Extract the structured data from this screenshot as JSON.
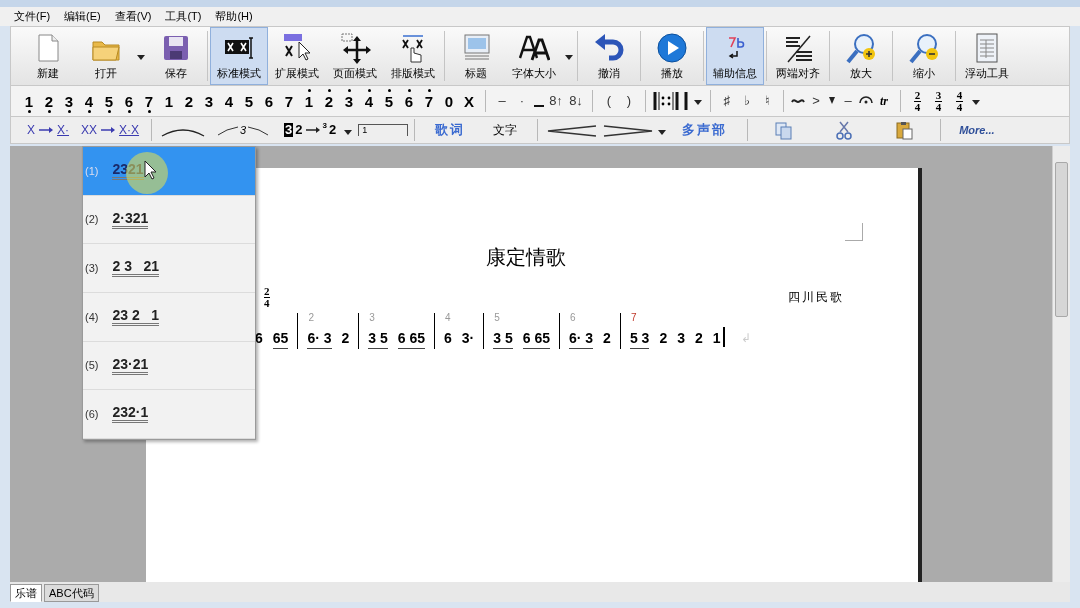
{
  "menu": [
    "文件(F)",
    "编辑(E)",
    "查看(V)",
    "工具(T)",
    "帮助(H)"
  ],
  "toolbar": [
    [
      {
        "kind": "button",
        "label": "新建",
        "selected": false
      },
      {
        "kind": "button",
        "label": "打开",
        "selected": false
      },
      {
        "kind": "dropdown"
      },
      {
        "kind": "button",
        "label": "保存",
        "selected": false
      }
    ],
    [
      {
        "kind": "button",
        "label": "标准模式",
        "selected": true
      },
      {
        "kind": "button",
        "label": "扩展模式",
        "selected": false
      },
      {
        "kind": "button",
        "label": "页面模式",
        "selected": false
      },
      {
        "kind": "button",
        "label": "排版模式",
        "selected": false
      }
    ],
    [
      {
        "kind": "button",
        "label": "标题",
        "selected": false
      },
      {
        "kind": "button",
        "label": "字体大小",
        "selected": false
      },
      {
        "kind": "dropdown"
      }
    ],
    [
      {
        "kind": "button",
        "label": "撤消",
        "selected": false
      }
    ],
    [
      {
        "kind": "button",
        "label": "播放",
        "selected": false
      }
    ],
    [
      {
        "kind": "button",
        "label": "辅助信息",
        "selected": true
      }
    ],
    [
      {
        "kind": "button",
        "label": "两端对齐",
        "selected": false
      }
    ],
    [
      {
        "kind": "button",
        "label": "放大",
        "selected": false
      }
    ],
    [
      {
        "kind": "button",
        "label": "缩小",
        "selected": false
      }
    ],
    [
      {
        "kind": "button",
        "label": "浮动工具",
        "selected": false
      }
    ]
  ],
  "note_bar": [
    [
      {
        "kind": "lownote",
        "t": "1"
      },
      {
        "kind": "lownote",
        "t": "2"
      },
      {
        "kind": "lownote",
        "t": "3"
      },
      {
        "kind": "lownote",
        "t": "4"
      },
      {
        "kind": "lownote",
        "t": "5"
      },
      {
        "kind": "lownote",
        "t": "6"
      },
      {
        "kind": "lownote",
        "t": "7"
      },
      {
        "kind": "note",
        "t": "1"
      },
      {
        "kind": "note",
        "t": "2"
      },
      {
        "kind": "note",
        "t": "3"
      },
      {
        "kind": "note",
        "t": "4"
      },
      {
        "kind": "note",
        "t": "5"
      },
      {
        "kind": "note",
        "t": "6"
      },
      {
        "kind": "note",
        "t": "7"
      },
      {
        "kind": "highnote",
        "t": "1"
      },
      {
        "kind": "highnote",
        "t": "2"
      },
      {
        "kind": "highnote",
        "t": "3"
      },
      {
        "kind": "highnote",
        "t": "4"
      },
      {
        "kind": "highnote",
        "t": "5"
      },
      {
        "kind": "highnote",
        "t": "6"
      },
      {
        "kind": "highnote",
        "t": "7"
      },
      {
        "kind": "note",
        "t": "0"
      },
      {
        "kind": "note",
        "t": "X"
      }
    ],
    [
      {
        "kind": "text",
        "t": "–"
      },
      {
        "kind": "text",
        "t": "·"
      },
      {
        "kind": "underline"
      },
      {
        "kind": "text",
        "t": "8↑"
      },
      {
        "kind": "text",
        "t": "8↓"
      }
    ],
    [
      {
        "kind": "text",
        "t": "("
      },
      {
        "kind": "text",
        "t": ")"
      }
    ],
    [
      {
        "kind": "repeatstart"
      },
      {
        "kind": "repeatend"
      },
      {
        "kind": "barline"
      },
      {
        "kind": "dropdown"
      }
    ],
    [
      {
        "kind": "text",
        "t": "♯"
      },
      {
        "kind": "text",
        "t": "♭"
      },
      {
        "kind": "text",
        "t": "♮"
      }
    ],
    [
      {
        "kind": "turn"
      },
      {
        "kind": "text",
        "t": ">"
      },
      {
        "kind": "staccato"
      },
      {
        "kind": "text",
        "t": "–"
      },
      {
        "kind": "fermata"
      },
      {
        "kind": "trill",
        "t": "tr"
      }
    ],
    [
      {
        "kind": "timesig",
        "num": "2",
        "den": "4"
      },
      {
        "kind": "timesig",
        "num": "3",
        "den": "4"
      },
      {
        "kind": "timesig",
        "num": "4",
        "den": "4"
      },
      {
        "kind": "dropdown"
      }
    ]
  ],
  "edit_bar": [
    [
      {
        "kind": "convert",
        "from": "X",
        "to": "X·"
      },
      {
        "kind": "convert",
        "from": "XX",
        "to": "X·X"
      }
    ],
    [
      {
        "kind": "slur"
      },
      {
        "kind": "triplet",
        "t": "3"
      },
      {
        "kind": "grace",
        "from_mark": "3",
        "from": "2",
        "to_mark": "3",
        "to": "2"
      },
      {
        "kind": "dropdown"
      },
      {
        "kind": "volta",
        "t": "1"
      }
    ],
    [
      {
        "kind": "link",
        "t": "歌词"
      },
      {
        "kind": "plain",
        "t": "文字"
      }
    ],
    [
      {
        "kind": "crescendo"
      },
      {
        "kind": "decrescendo"
      },
      {
        "kind": "dropdown"
      },
      {
        "kind": "link",
        "t": "多声部"
      }
    ],
    [
      {
        "kind": "copy"
      },
      {
        "kind": "cut"
      },
      {
        "kind": "paste"
      }
    ],
    [
      {
        "kind": "more",
        "t": "More..."
      }
    ]
  ],
  "score": {
    "title": "康定情歌",
    "composer": "四川民歌",
    "time_signature": {
      "num": "2",
      "den": "4"
    },
    "measures": [
      {
        "groups": [
          {
            "t": "6",
            "underlined": false
          },
          {
            "t": "65",
            "underlined": true
          }
        ]
      },
      {
        "number": "2",
        "current": false,
        "groups": [
          {
            "t": "6· 3",
            "underlined": true
          },
          {
            "t": "2",
            "underlined": false
          }
        ]
      },
      {
        "number": "3",
        "current": false,
        "groups": [
          {
            "t": "3 5",
            "underlined": true
          },
          {
            "t": "6 65",
            "underlined": true
          }
        ]
      },
      {
        "number": "4",
        "current": false,
        "groups": [
          {
            "t": "6",
            "underlined": false
          },
          {
            "t": "3·",
            "underlined": false
          }
        ]
      },
      {
        "number": "5",
        "current": false,
        "groups": [
          {
            "t": "3 5",
            "underlined": true
          },
          {
            "t": "6 65",
            "underlined": true
          }
        ]
      },
      {
        "number": "6",
        "current": false,
        "groups": [
          {
            "t": "6· 3",
            "underlined": true
          },
          {
            "t": "2",
            "underlined": false
          }
        ]
      },
      {
        "number": "7",
        "current": true,
        "groups": [
          {
            "t": "5 3",
            "underlined": true
          },
          {
            "t": "2",
            "underlined": false
          },
          {
            "t": "3",
            "underlined": false
          },
          {
            "t": "2",
            "underlined": false
          },
          {
            "t": "1",
            "underlined": false
          }
        ]
      }
    ],
    "end_mark": "↲"
  },
  "pattern_menu": [
    {
      "label": "(1)",
      "pattern": "2321",
      "selected": true
    },
    {
      "label": "(2)",
      "pattern": "2·321",
      "selected": false
    },
    {
      "label": "(3)",
      "pattern": "2 3   21",
      "selected": false
    },
    {
      "label": "(4)",
      "pattern": "23 2   1",
      "selected": false
    },
    {
      "label": "(5)",
      "pattern": "23·21",
      "selected": false
    },
    {
      "label": "(6)",
      "pattern": "232·1",
      "selected": false
    }
  ],
  "tabs": [
    {
      "label": "乐谱",
      "selected": true
    },
    {
      "label": "ABC代码",
      "selected": false
    }
  ]
}
